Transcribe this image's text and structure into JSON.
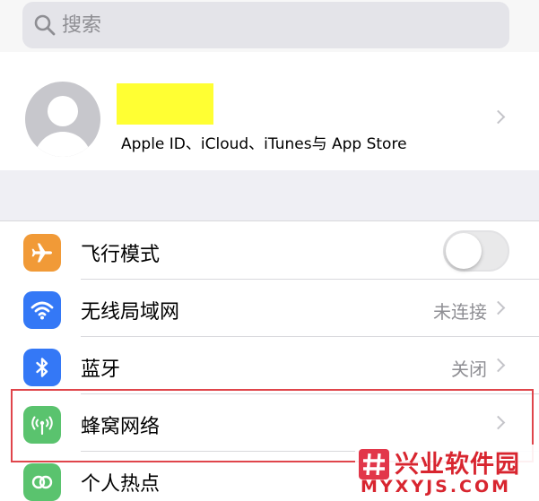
{
  "search": {
    "placeholder": "搜索"
  },
  "profile": {
    "subtitle": "Apple ID、iCloud、iTunes与 App Store"
  },
  "settings": [
    {
      "label": "飞行模式",
      "icon": "airplane-icon",
      "color": "#f19a37",
      "toggle": false
    },
    {
      "label": "无线局域网",
      "icon": "wifi-icon",
      "color": "#3478f6",
      "value": "未连接"
    },
    {
      "label": "蓝牙",
      "icon": "bluetooth-icon",
      "color": "#3478f6",
      "value": "关闭"
    },
    {
      "label": "蜂窝网络",
      "icon": "cellular-antenna-icon",
      "color": "#5ac36e",
      "value": ""
    },
    {
      "label": "个人热点",
      "icon": "personal-hotspot-icon",
      "color": "#5ac36e"
    }
  ],
  "highlight_color": "#e0454b",
  "watermark": {
    "title": "兴业软件园",
    "url": "MYXYJS.COM",
    "color": "#d8252f"
  }
}
